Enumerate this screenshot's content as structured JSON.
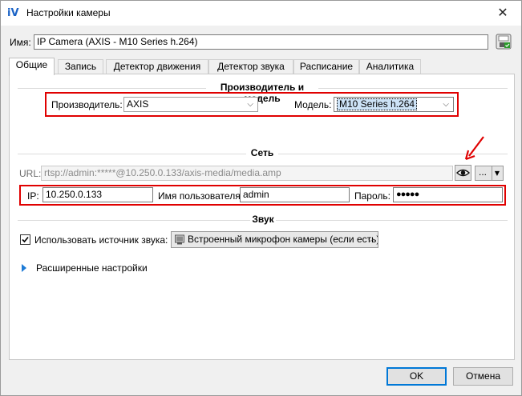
{
  "window": {
    "title": "Настройки камеры",
    "close_glyph": "✕"
  },
  "name_row": {
    "label": "Имя:",
    "value": "IP Camera (AXIS - M10 Series h.264)"
  },
  "tabs": [
    {
      "label": "Общие",
      "active": true
    },
    {
      "label": "Запись"
    },
    {
      "label": "Детектор движения"
    },
    {
      "label": "Детектор звука"
    },
    {
      "label": "Расписание"
    },
    {
      "label": "Аналитика"
    }
  ],
  "manufacturer_section": {
    "title": "Производитель и модель",
    "manufacturer_label": "Производитель:",
    "manufacturer_value": "AXIS",
    "model_label": "Модель:",
    "model_value": "M10 Series h.264"
  },
  "network_section": {
    "title": "Сеть",
    "url_label": "URL:",
    "url_value": "rtsp://admin:*****@10.250.0.133/axis-media/media.amp",
    "more_label": "...",
    "ip_label": "IP:",
    "ip_value": "10.250.0.133",
    "user_label": "Имя пользователя:",
    "user_value": "admin",
    "password_label": "Пароль:",
    "password_value": "●●●●●"
  },
  "sound_section": {
    "title": "Звук",
    "use_source_label": "Использовать источник звука:",
    "use_source_checked": true,
    "source_value": "Встроенный микрофон камеры (если есть)"
  },
  "advanced": {
    "label": "Расширенные настройки"
  },
  "buttons": {
    "ok": "OK",
    "cancel": "Отмена"
  },
  "colors": {
    "highlight": "#e00000",
    "accent": "#0078d7",
    "icon": "#1b63c6"
  },
  "icons": [
    "app-icon",
    "save-icon",
    "eye-icon",
    "chevron-down-icon",
    "expand-arrow-icon",
    "checkbox-icon",
    "microphone-icon",
    "red-arrow-annotation"
  ]
}
